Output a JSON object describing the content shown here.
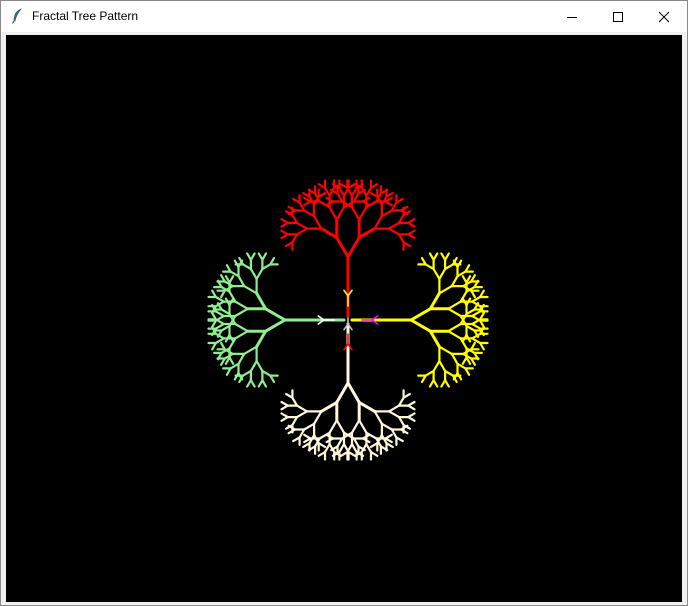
{
  "window": {
    "title": "Fractal Tree Pattern",
    "icon": "feather-icon",
    "controls": [
      "minimize-icon",
      "maximize-icon",
      "close-icon"
    ]
  },
  "canvas": {
    "background": "#000000",
    "trees": [
      {
        "name": "red-tree",
        "color": "#ff0000",
        "direction": "up",
        "depth": 6,
        "branch_angle_deg": 30
      },
      {
        "name": "yellow-tree",
        "color": "#ffff00",
        "direction": "right",
        "depth": 6,
        "branch_angle_deg": 30
      },
      {
        "name": "cream-tree",
        "color": "#fff8dc",
        "direction": "down",
        "depth": 6,
        "branch_angle_deg": 30
      },
      {
        "name": "green-tree",
        "color": "#90ee90",
        "direction": "left",
        "depth": 6,
        "branch_angle_deg": 30
      }
    ],
    "small_arrows": [
      {
        "name": "yellow-arrow",
        "color": "#ffff00",
        "direction": "up"
      },
      {
        "name": "white-arrow",
        "color": "#ffffff",
        "direction": "left"
      },
      {
        "name": "magenta-arrow",
        "color": "#ff00ff",
        "direction": "right"
      },
      {
        "name": "red-arrow",
        "color": "#ff0000",
        "direction": "down"
      },
      {
        "name": "gray-arrow",
        "color": "#c0c0c0",
        "direction": "down"
      }
    ]
  }
}
